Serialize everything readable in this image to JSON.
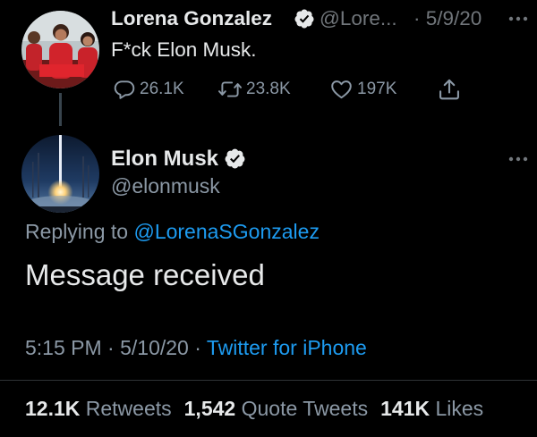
{
  "parent_tweet": {
    "display_name": "Lorena Gonzalez",
    "handle": "@Lore...",
    "date": "· 5/9/20",
    "text": "F*ck Elon Musk.",
    "avatar_icon": "group-photo-avatar",
    "verified_icon": "verified-badge-icon",
    "more_icon": "more-options-icon",
    "actions": {
      "reply_count": "26.1K",
      "retweet_count": "23.8K",
      "like_count": "197K"
    }
  },
  "main_tweet": {
    "display_name": "Elon Musk",
    "handle": "@elonmusk",
    "avatar_icon": "rocket-launch-avatar",
    "verified_icon": "verified-badge-icon",
    "more_icon": "more-options-icon",
    "replying_prefix": "Replying to ",
    "replying_to": "@LorenaSGonzalez",
    "text": "Message received",
    "time": "5:15 PM · 5/10/20 · ",
    "source": "Twitter for iPhone",
    "stats": {
      "retweets_value": "12.1K",
      "retweets_label": "Retweets",
      "quotes_value": "1,542",
      "quotes_label": "Quote Tweets",
      "likes_value": "141K",
      "likes_label": "Likes"
    }
  },
  "colors": {
    "background": "#000000",
    "primary_text": "#e7e9ea",
    "secondary_text": "#8b98a5",
    "link": "#1d9bf0",
    "divider": "#2f3336"
  }
}
